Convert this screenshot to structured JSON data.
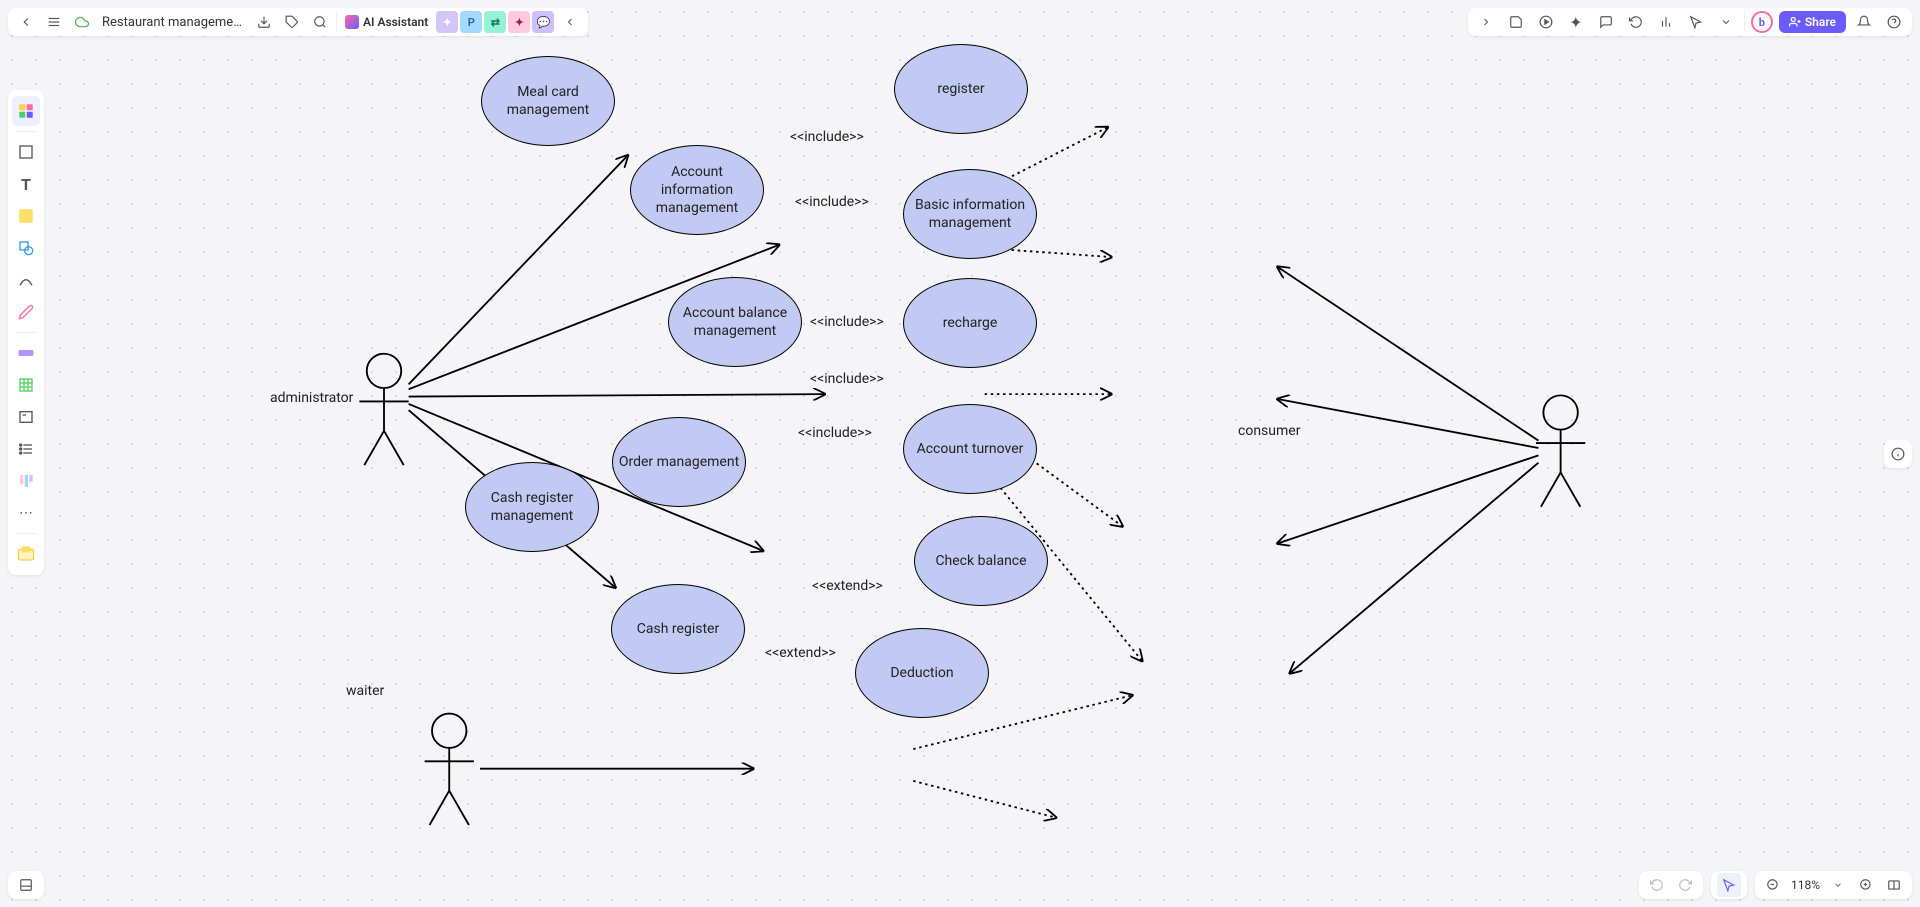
{
  "header": {
    "title": "Restaurant management ...",
    "ai_label": "AI Assistant",
    "collab": [
      "",
      "P",
      "",
      "",
      ""
    ],
    "share_label": "Share"
  },
  "zoom": "118%",
  "actors": {
    "administrator": "administrator",
    "waiter": "waiter",
    "consumer": "consumer"
  },
  "usecases": {
    "meal_card": "Meal card management",
    "account_info": "Account information management",
    "account_balance": "Account balance management",
    "order_mgmt": "Order management",
    "cash_reg_mgmt": "Cash register management",
    "register": "register",
    "basic_info": "Basic information management",
    "recharge": "recharge",
    "account_turnover": "Account turnover",
    "check_balance": "Check balance",
    "cash_register": "Cash register",
    "deduction": "Deduction"
  },
  "relations": {
    "include1": "<<include>>",
    "include2": "<<include>>",
    "include3": "<<include>>",
    "include4": "<<include>>",
    "include5": "<<include>>",
    "extend1": "<<extend>>",
    "extend2": "<<extend>>"
  }
}
